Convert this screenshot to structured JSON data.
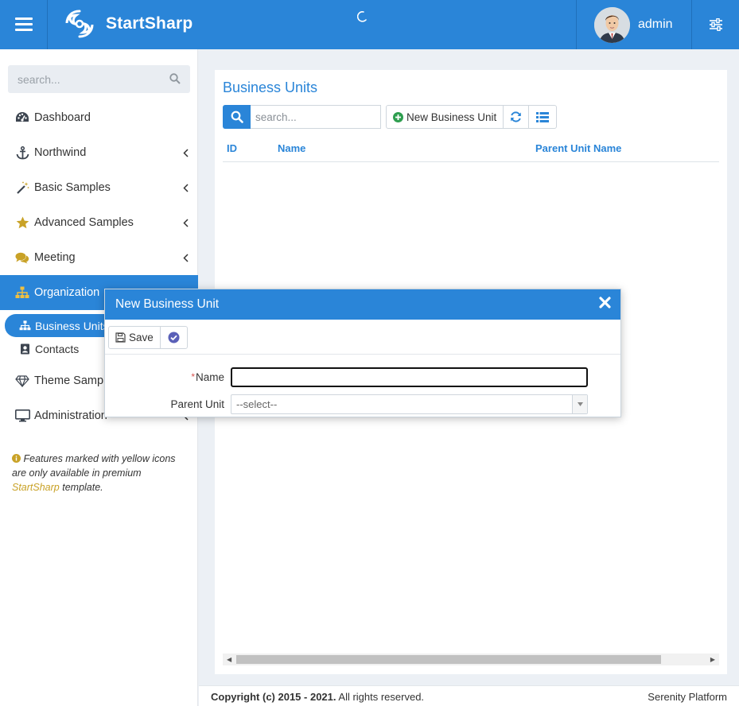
{
  "app": {
    "name": "StartSharp"
  },
  "header": {
    "user_name": "admin"
  },
  "sidebar": {
    "search_placeholder": "search...",
    "items": [
      {
        "label": "Dashboard",
        "icon": "dashboard-icon"
      },
      {
        "label": "Northwind",
        "icon": "anchor-icon"
      },
      {
        "label": "Basic Samples",
        "icon": "magic-wand-icon"
      },
      {
        "label": "Advanced Samples",
        "icon": "star-icon"
      },
      {
        "label": "Meeting",
        "icon": "comments-icon"
      },
      {
        "label": "Organization",
        "icon": "sitemap-icon"
      },
      {
        "label": "Theme Samples",
        "icon": "diamond-icon"
      },
      {
        "label": "Administration",
        "icon": "desktop-icon"
      }
    ],
    "sub_items": [
      {
        "label": "Business Units",
        "icon": "sitemap-icon"
      },
      {
        "label": "Contacts",
        "icon": "contact-card-icon"
      }
    ],
    "note": {
      "part1": "Features marked with yellow icons are only available in premium ",
      "brand": "StartSharp",
      "part2": " template."
    }
  },
  "page": {
    "title": "Business Units",
    "search_placeholder": "search...",
    "new_button": "New Business Unit",
    "columns": [
      "ID",
      "Name",
      "Parent Unit Name"
    ]
  },
  "footer": {
    "copyright_bold": "Copyright (c) 2015 - 2021.",
    "copyright_rest": " All rights reserved.",
    "platform": "Serenity Platform"
  },
  "dialog": {
    "title": "New Business Unit",
    "save_label": "Save",
    "name_label": "Name",
    "name_value": "",
    "parent_label": "Parent Unit",
    "parent_value": "--select--"
  },
  "colors": {
    "primary": "#2a85d8",
    "accent_yellow": "#c9a227",
    "save_check": "#5a60b8"
  }
}
